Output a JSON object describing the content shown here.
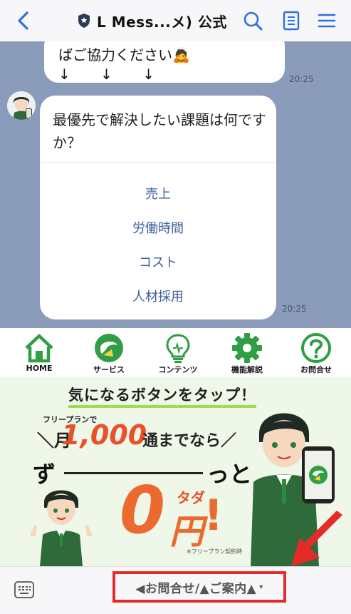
{
  "header": {
    "title": "L Mess...メ) 公式"
  },
  "chat": {
    "prev_message_line1": "ばご協力ください🙇",
    "prev_message_line2": "↓ ↓ ↓",
    "prev_time": "20:25",
    "question": "最優先で解決したい課題は何ですか？",
    "options": [
      "売上",
      "労働時間",
      "コスト",
      "人材採用"
    ],
    "question_time": "20:25"
  },
  "rich_menu": {
    "items": [
      {
        "label": "HOME",
        "icon": "home-icon"
      },
      {
        "label": "サービス",
        "icon": "service-icon"
      },
      {
        "label": "コンテンツ",
        "icon": "lightbulb-icon"
      },
      {
        "label": "機能解説",
        "icon": "gear-icon"
      },
      {
        "label": "お問合せ",
        "icon": "question-icon"
      }
    ],
    "banner": {
      "headline": "気になるボタンをタップ！",
      "free_plan": "フリープランで",
      "month_prefix": "＼月",
      "count": "1,000",
      "count_suffix": "通までなら／",
      "zu": "ず",
      "tto": "っと",
      "tada": "タダ",
      "zero": "0",
      "en": "円",
      "excl": "!",
      "note": "※フリープラン契約時"
    }
  },
  "bottom_bar": {
    "menu_label": "◀お問合せ/▲ご案内▲",
    "chevron": "▾"
  },
  "colors": {
    "chat_bg": "#8a9cba",
    "option_text": "#3d5f9b",
    "menu_green": "#2f9e44",
    "accent_orange": "#ec6a2f",
    "highlight_red": "#e62a2a"
  }
}
